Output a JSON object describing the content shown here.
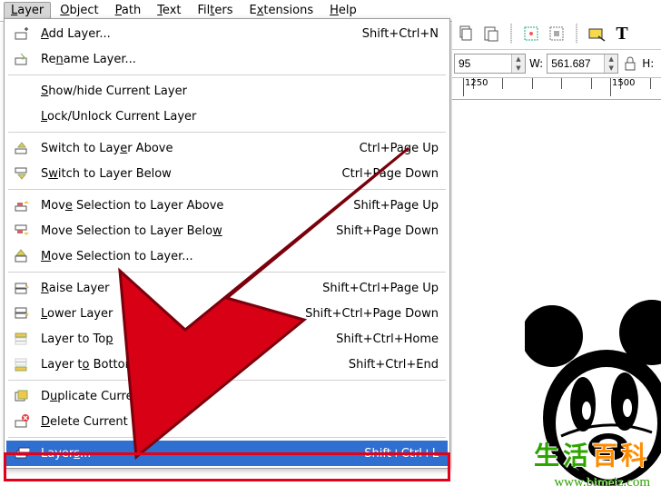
{
  "menubar": {
    "items": [
      "Layer",
      "Object",
      "Path",
      "Text",
      "Filters",
      "Extensions",
      "Help"
    ],
    "underline_idx": [
      0,
      0,
      0,
      0,
      3,
      1,
      0
    ],
    "active_index": 0
  },
  "menu": {
    "items": [
      {
        "icon": "add-layer-icon",
        "label": "Add Layer...",
        "underline": "A",
        "shortcut": "Shift+Ctrl+N"
      },
      {
        "icon": "rename-icon",
        "label": "Rename Layer...",
        "underline": "n",
        "shortcut": ""
      },
      {
        "sep": true
      },
      {
        "icon": "",
        "label": "Show/hide Current Layer",
        "underline": "S",
        "shortcut": ""
      },
      {
        "icon": "",
        "label": "Lock/Unlock Current Layer",
        "underline": "L",
        "shortcut": ""
      },
      {
        "sep": true
      },
      {
        "icon": "arrow-up-icon",
        "label": "Switch to Layer Above",
        "underline": "e",
        "shortcut": "Ctrl+Page Up"
      },
      {
        "icon": "arrow-down-icon",
        "label": "Switch to Layer Below",
        "underline": "w",
        "shortcut": "Ctrl+Page Down"
      },
      {
        "sep": true
      },
      {
        "icon": "move-up-icon",
        "label": "Move Selection to Layer Above",
        "underline": "e",
        "shortcut": "Shift+Page Up"
      },
      {
        "icon": "move-down-icon",
        "label": "Move Selection to Layer Below",
        "underline": "w",
        "shortcut": "Shift+Page Down"
      },
      {
        "icon": "move-to-icon",
        "label": "Move Selection to Layer...",
        "underline": "M",
        "shortcut": ""
      },
      {
        "sep": true
      },
      {
        "icon": "raise-icon",
        "label": "Raise Layer",
        "underline": "R",
        "shortcut": "Shift+Ctrl+Page Up"
      },
      {
        "icon": "lower-icon",
        "label": "Lower Layer",
        "underline": "L",
        "shortcut": "Shift+Ctrl+Page Down"
      },
      {
        "icon": "top-icon",
        "label": "Layer to Top",
        "underline": "p",
        "shortcut": "Shift+Ctrl+Home"
      },
      {
        "icon": "bottom-icon",
        "label": "Layer to Bottom",
        "underline": "o",
        "shortcut": "Shift+Ctrl+End"
      },
      {
        "sep": true
      },
      {
        "icon": "duplicate-icon",
        "label": "Duplicate Current Layer",
        "underline": "u",
        "shortcut": ""
      },
      {
        "icon": "delete-icon",
        "label": "Delete Current Layer",
        "underline": "D",
        "shortcut": ""
      },
      {
        "sep": true
      },
      {
        "icon": "layers-icon",
        "label": "Layers...",
        "underline": "s",
        "shortcut": "Shift+Ctrl+L",
        "highlight": true
      }
    ]
  },
  "fields": {
    "value_left": "95",
    "w_label": "W:",
    "w_value": "561.687",
    "lock_icon": "lock-icon",
    "h_label": "H:"
  },
  "ruler": {
    "major_ticks": [
      {
        "pos": 12,
        "label": "1250"
      },
      {
        "pos": 174,
        "label": "1500"
      }
    ]
  },
  "watermark": {
    "green": "生活",
    "orange": "百科",
    "url": "www.bimeiz.com"
  }
}
